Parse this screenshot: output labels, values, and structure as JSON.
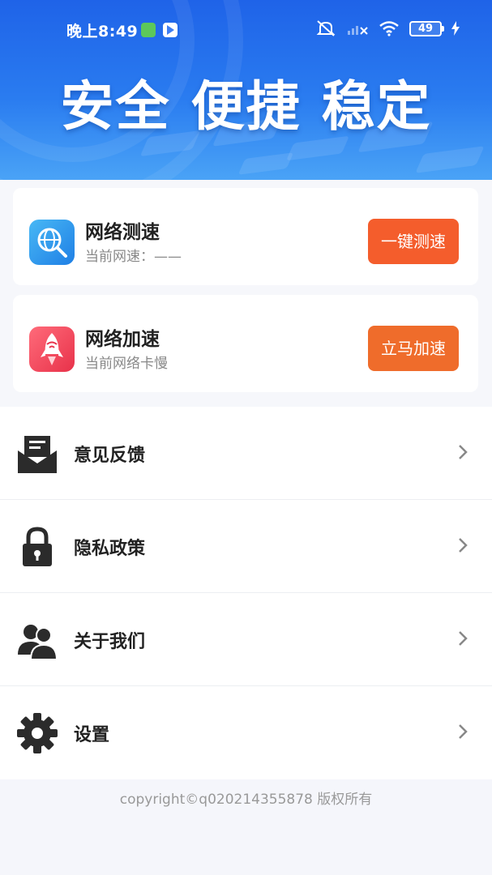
{
  "status_bar": {
    "time": "晚上8:49",
    "battery": "49"
  },
  "banner": {
    "slogan": "安全 便捷 稳定"
  },
  "cards": [
    {
      "title": "网络测速",
      "subtitle": "当前网速：——",
      "button": "一键测速",
      "button_color": "#f45d2c",
      "icon": "globe-search-icon"
    },
    {
      "title": "网络加速",
      "subtitle": "当前网络卡慢",
      "button": "立马加速",
      "button_color": "#ef6c2b",
      "icon": "rocket-icon"
    }
  ],
  "menu": [
    {
      "label": "意见反馈",
      "icon": "feedback-mail-icon"
    },
    {
      "label": "隐私政策",
      "icon": "lock-icon"
    },
    {
      "label": "关于我们",
      "icon": "users-icon"
    },
    {
      "label": "设置",
      "icon": "gear-icon"
    }
  ],
  "footer": {
    "copyright": "copyright©q020214355878 版权所有"
  },
  "colors": {
    "banner_top": "#1f63e8",
    "banner_bottom": "#4aa3f6",
    "text_primary": "#222222",
    "text_secondary": "#888888"
  }
}
